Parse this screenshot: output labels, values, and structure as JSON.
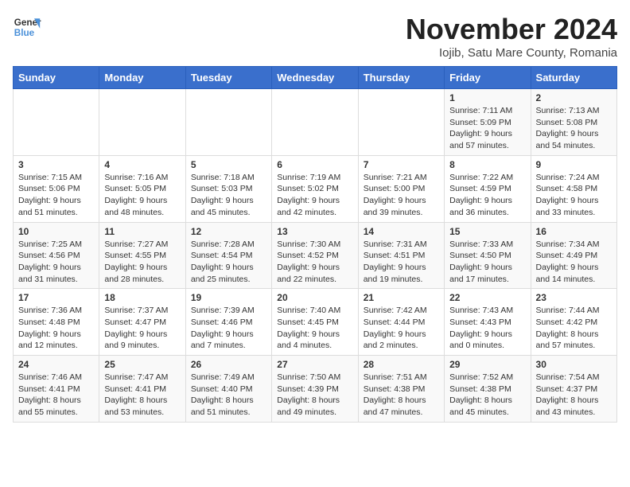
{
  "header": {
    "logo_line1": "General",
    "logo_line2": "Blue",
    "month_year": "November 2024",
    "location": "Iojib, Satu Mare County, Romania"
  },
  "weekdays": [
    "Sunday",
    "Monday",
    "Tuesday",
    "Wednesday",
    "Thursday",
    "Friday",
    "Saturday"
  ],
  "weeks": [
    [
      {
        "day": "",
        "detail": ""
      },
      {
        "day": "",
        "detail": ""
      },
      {
        "day": "",
        "detail": ""
      },
      {
        "day": "",
        "detail": ""
      },
      {
        "day": "",
        "detail": ""
      },
      {
        "day": "1",
        "detail": "Sunrise: 7:11 AM\nSunset: 5:09 PM\nDaylight: 9 hours and 57 minutes."
      },
      {
        "day": "2",
        "detail": "Sunrise: 7:13 AM\nSunset: 5:08 PM\nDaylight: 9 hours and 54 minutes."
      }
    ],
    [
      {
        "day": "3",
        "detail": "Sunrise: 7:15 AM\nSunset: 5:06 PM\nDaylight: 9 hours and 51 minutes."
      },
      {
        "day": "4",
        "detail": "Sunrise: 7:16 AM\nSunset: 5:05 PM\nDaylight: 9 hours and 48 minutes."
      },
      {
        "day": "5",
        "detail": "Sunrise: 7:18 AM\nSunset: 5:03 PM\nDaylight: 9 hours and 45 minutes."
      },
      {
        "day": "6",
        "detail": "Sunrise: 7:19 AM\nSunset: 5:02 PM\nDaylight: 9 hours and 42 minutes."
      },
      {
        "day": "7",
        "detail": "Sunrise: 7:21 AM\nSunset: 5:00 PM\nDaylight: 9 hours and 39 minutes."
      },
      {
        "day": "8",
        "detail": "Sunrise: 7:22 AM\nSunset: 4:59 PM\nDaylight: 9 hours and 36 minutes."
      },
      {
        "day": "9",
        "detail": "Sunrise: 7:24 AM\nSunset: 4:58 PM\nDaylight: 9 hours and 33 minutes."
      }
    ],
    [
      {
        "day": "10",
        "detail": "Sunrise: 7:25 AM\nSunset: 4:56 PM\nDaylight: 9 hours and 31 minutes."
      },
      {
        "day": "11",
        "detail": "Sunrise: 7:27 AM\nSunset: 4:55 PM\nDaylight: 9 hours and 28 minutes."
      },
      {
        "day": "12",
        "detail": "Sunrise: 7:28 AM\nSunset: 4:54 PM\nDaylight: 9 hours and 25 minutes."
      },
      {
        "day": "13",
        "detail": "Sunrise: 7:30 AM\nSunset: 4:52 PM\nDaylight: 9 hours and 22 minutes."
      },
      {
        "day": "14",
        "detail": "Sunrise: 7:31 AM\nSunset: 4:51 PM\nDaylight: 9 hours and 19 minutes."
      },
      {
        "day": "15",
        "detail": "Sunrise: 7:33 AM\nSunset: 4:50 PM\nDaylight: 9 hours and 17 minutes."
      },
      {
        "day": "16",
        "detail": "Sunrise: 7:34 AM\nSunset: 4:49 PM\nDaylight: 9 hours and 14 minutes."
      }
    ],
    [
      {
        "day": "17",
        "detail": "Sunrise: 7:36 AM\nSunset: 4:48 PM\nDaylight: 9 hours and 12 minutes."
      },
      {
        "day": "18",
        "detail": "Sunrise: 7:37 AM\nSunset: 4:47 PM\nDaylight: 9 hours and 9 minutes."
      },
      {
        "day": "19",
        "detail": "Sunrise: 7:39 AM\nSunset: 4:46 PM\nDaylight: 9 hours and 7 minutes."
      },
      {
        "day": "20",
        "detail": "Sunrise: 7:40 AM\nSunset: 4:45 PM\nDaylight: 9 hours and 4 minutes."
      },
      {
        "day": "21",
        "detail": "Sunrise: 7:42 AM\nSunset: 4:44 PM\nDaylight: 9 hours and 2 minutes."
      },
      {
        "day": "22",
        "detail": "Sunrise: 7:43 AM\nSunset: 4:43 PM\nDaylight: 9 hours and 0 minutes."
      },
      {
        "day": "23",
        "detail": "Sunrise: 7:44 AM\nSunset: 4:42 PM\nDaylight: 8 hours and 57 minutes."
      }
    ],
    [
      {
        "day": "24",
        "detail": "Sunrise: 7:46 AM\nSunset: 4:41 PM\nDaylight: 8 hours and 55 minutes."
      },
      {
        "day": "25",
        "detail": "Sunrise: 7:47 AM\nSunset: 4:41 PM\nDaylight: 8 hours and 53 minutes."
      },
      {
        "day": "26",
        "detail": "Sunrise: 7:49 AM\nSunset: 4:40 PM\nDaylight: 8 hours and 51 minutes."
      },
      {
        "day": "27",
        "detail": "Sunrise: 7:50 AM\nSunset: 4:39 PM\nDaylight: 8 hours and 49 minutes."
      },
      {
        "day": "28",
        "detail": "Sunrise: 7:51 AM\nSunset: 4:38 PM\nDaylight: 8 hours and 47 minutes."
      },
      {
        "day": "29",
        "detail": "Sunrise: 7:52 AM\nSunset: 4:38 PM\nDaylight: 8 hours and 45 minutes."
      },
      {
        "day": "30",
        "detail": "Sunrise: 7:54 AM\nSunset: 4:37 PM\nDaylight: 8 hours and 43 minutes."
      }
    ]
  ]
}
